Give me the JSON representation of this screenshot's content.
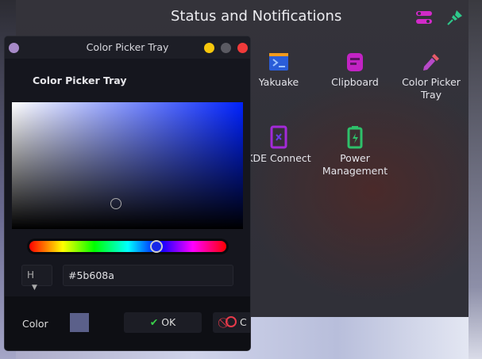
{
  "panel": {
    "title": "Status and Notifications",
    "configure_icon": "settings-sliders-icon",
    "pin_icon": "pin-icon"
  },
  "apps": [
    {
      "label": "Yakuake",
      "icon": "terminal-icon"
    },
    {
      "label": "Clipboard",
      "icon": "clipboard-icon"
    },
    {
      "label": "Color Picker Tray",
      "icon": "eyedropper-icon"
    },
    {
      "label": "KDE Connect",
      "icon": "kde-connect-icon"
    },
    {
      "label": "Power Management",
      "icon": "battery-icon"
    }
  ],
  "dialog": {
    "title": "Color Picker Tray",
    "heading": "Color Picker Tray",
    "mode": "H",
    "hex_value": "#5b608a",
    "color_label": "Color",
    "ok_label": "OK",
    "cancel_label": "C",
    "hue_fraction": 0.66,
    "current_color": "#5b608a"
  }
}
